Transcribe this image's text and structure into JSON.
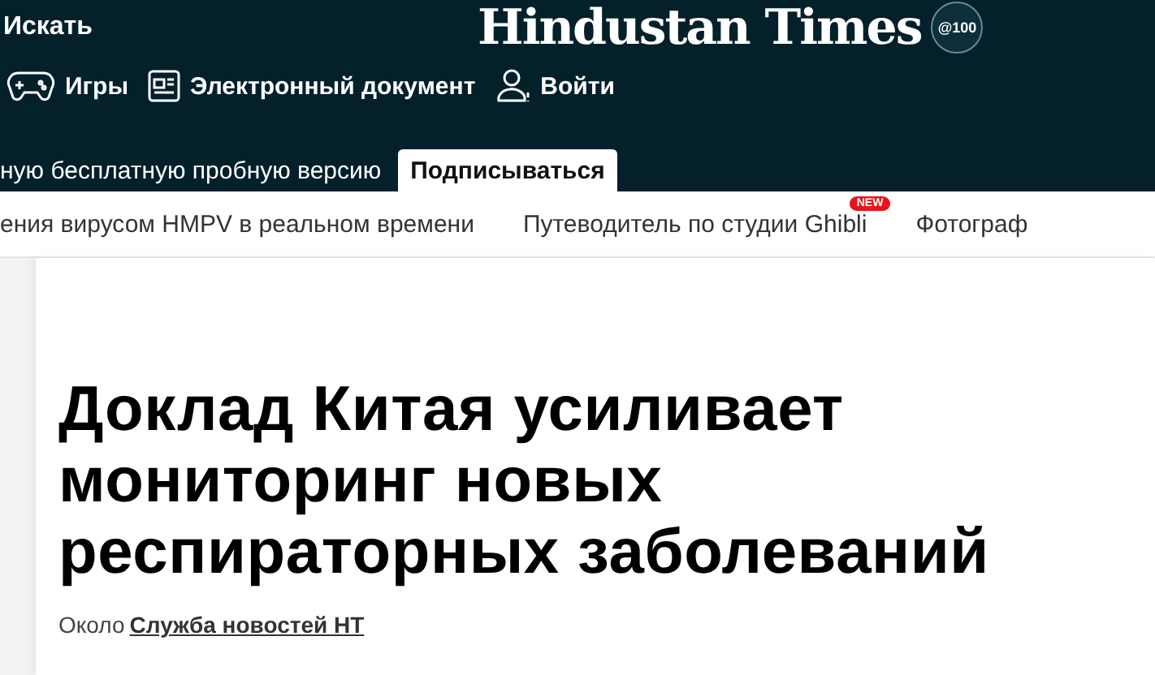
{
  "header": {
    "search_label": "Искать",
    "logo": "Hindustan Times",
    "logo_badge": "@100",
    "links": [
      {
        "kind": "games",
        "label": "Игры"
      },
      {
        "kind": "epaper",
        "label": "Электронный документ"
      },
      {
        "kind": "login",
        "label": "Войти"
      }
    ],
    "trial_text": "ную бесплатную пробную версию",
    "subscribe": "Подписываться"
  },
  "nav": [
    {
      "label": "ения вирусом HMPV в реальном времени"
    },
    {
      "label": "Путеводитель по студии Ghibli",
      "badge": "NEW"
    },
    {
      "label": "Фотограф"
    }
  ],
  "article": {
    "headline": "Доклад Китая усиливает мониторинг новых респираторных заболеваний",
    "byline_prefix": "Около",
    "author": "Служба новостей НТ"
  }
}
